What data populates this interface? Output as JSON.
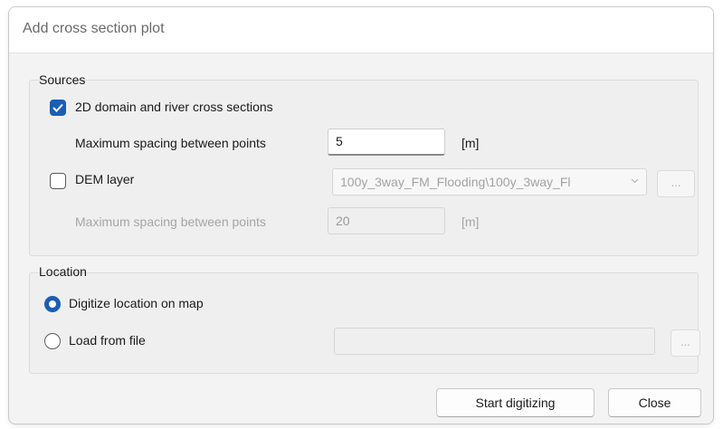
{
  "dialog": {
    "title": "Add cross section plot"
  },
  "sources": {
    "label": "Sources",
    "domain_checkbox": {
      "label": "2D domain and river cross sections",
      "checked": true
    },
    "domain_spacing": {
      "label": "Maximum spacing between points",
      "value": "5",
      "unit": "[m]"
    },
    "dem_checkbox": {
      "label": "DEM layer",
      "checked": false
    },
    "dem_layer_select": {
      "value": "100y_3way_FM_Flooding\\100y_3way_Fl"
    },
    "dem_browse_label": "...",
    "dem_spacing": {
      "label": "Maximum spacing between points",
      "value": "20",
      "unit": "[m]"
    }
  },
  "location": {
    "label": "Location",
    "digitize_option": {
      "label": "Digitize location on map",
      "selected": true
    },
    "file_option": {
      "label": "Load from file",
      "selected": false
    },
    "file_path": "",
    "browse_label": "..."
  },
  "buttons": {
    "start": "Start digitizing",
    "close": "Close"
  },
  "colors": {
    "accent": "#1a5fb4"
  }
}
